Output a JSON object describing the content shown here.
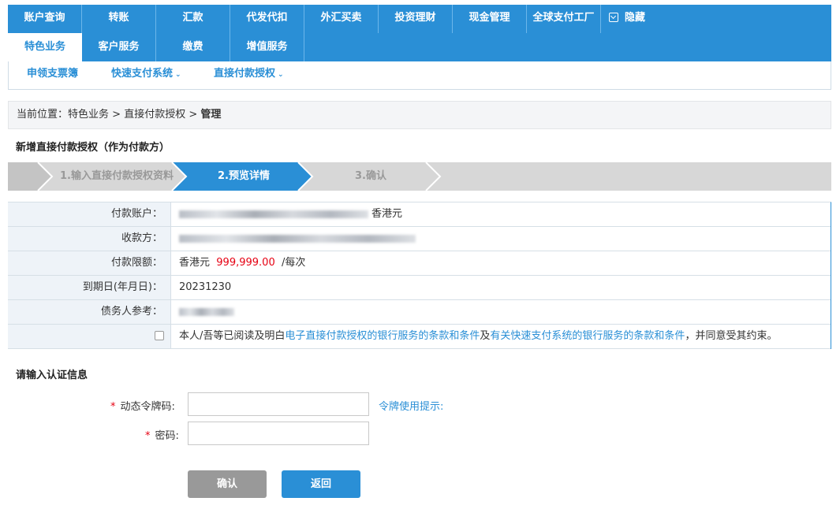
{
  "nav_main": [
    "账户查询",
    "转账",
    "汇款",
    "代发代扣",
    "外汇买卖",
    "投资理财",
    "现金管理",
    "全球支付工厂"
  ],
  "nav_hide_label": "隐藏",
  "nav_sub": [
    "特色业务",
    "客户服务",
    "缴费",
    "增值服务"
  ],
  "nav_sub_active": "特色业务",
  "nav_third": [
    "申领支票簿",
    "快速支付系统",
    "直接付款授权"
  ],
  "breadcrumb": {
    "prefix": "当前位置：",
    "path": [
      "特色业务",
      "直接付款授权"
    ],
    "current": "管理",
    "separator": " > "
  },
  "page_title": "新增直接付款授权（作为付款方）",
  "steps": [
    {
      "label": "1.输入直接付款授权资料",
      "state": "done"
    },
    {
      "label": "2.预览详情",
      "state": "active"
    },
    {
      "label": "3.确认",
      "state": "pending"
    }
  ],
  "details": {
    "payer_account_label": "付款账户：",
    "payer_currency": "香港元",
    "payee_label": "收款方：",
    "limit_label": "付款限额：",
    "limit_currency": "香港元",
    "limit_amount": "999,999.00",
    "limit_unit": "/每次",
    "expiry_label": "到期日(年月日)：",
    "expiry_value": "20231230",
    "debtor_ref_label": "债务人参考：",
    "agreement_prefix": "本人/吾等已阅读及明白",
    "agreement_link1": "电子直接付款授权的银行服务的条款和条件",
    "agreement_mid": "及",
    "agreement_link2": "有关快速支付系统的银行服务的条款和条件",
    "agreement_suffix": "，并同意受其约束。"
  },
  "auth": {
    "title": "请输入认证信息",
    "token_label": "动态令牌码:",
    "token_value": "",
    "token_hint": "令牌使用提示:",
    "password_label": "密码:",
    "password_value": "",
    "required_mark": "*"
  },
  "buttons": {
    "confirm": "确认",
    "back": "返回"
  },
  "colors": {
    "primary": "#2a8fd6",
    "amount": "#e60012",
    "step_inactive": "#d7d7d7"
  }
}
